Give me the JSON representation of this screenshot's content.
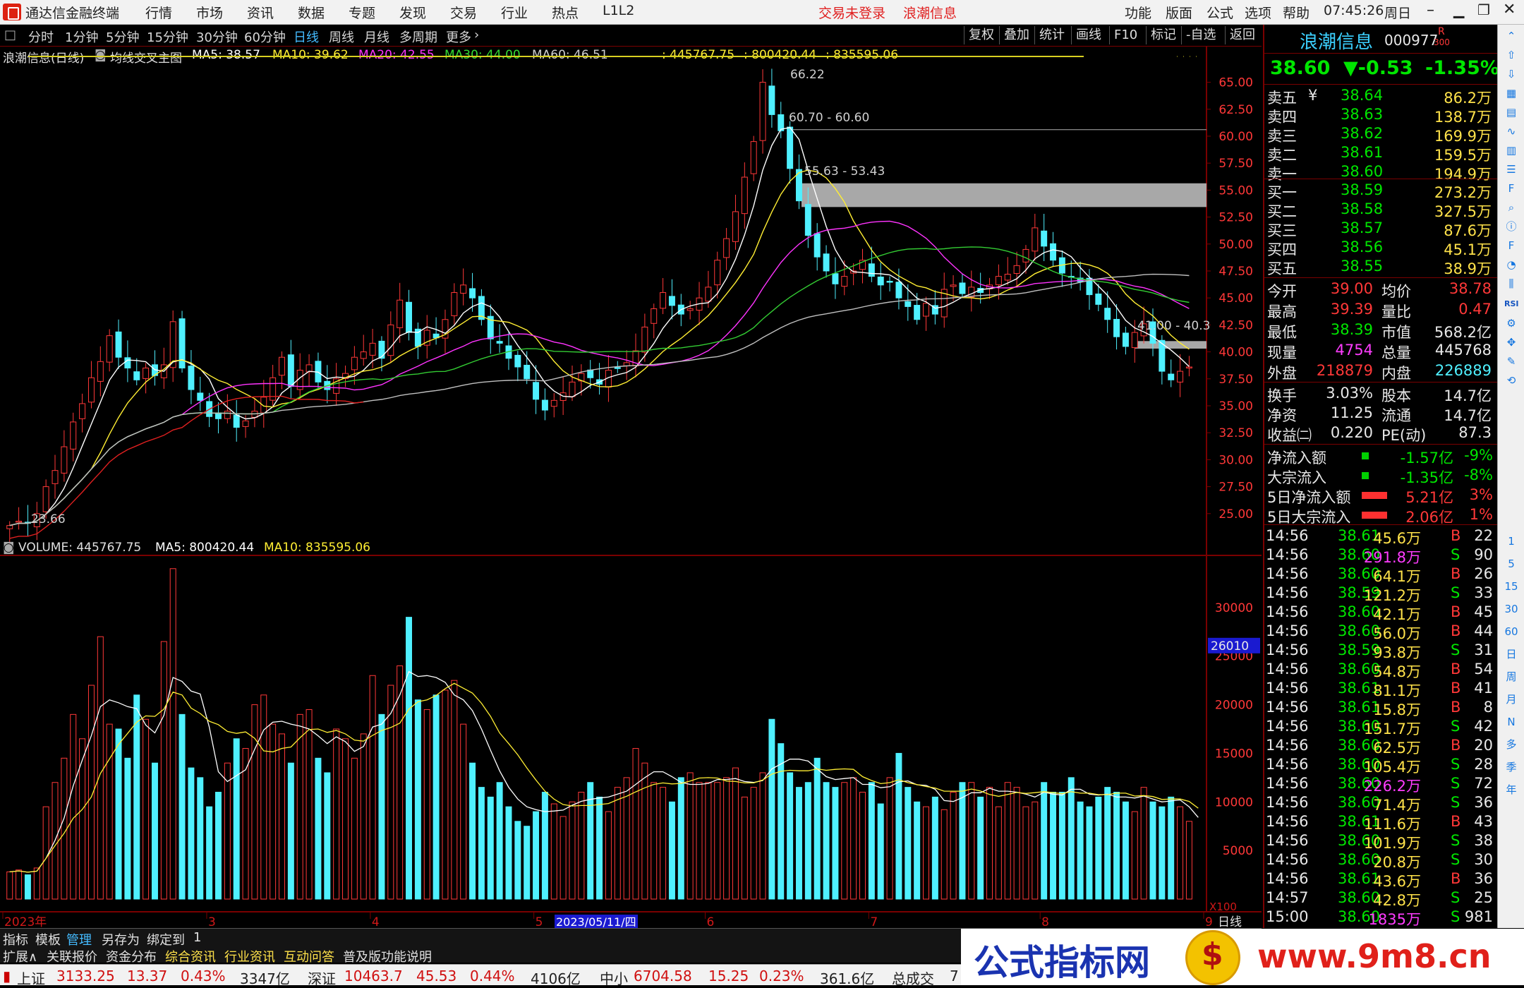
{
  "titlebar": {
    "app_title": "通达信金融终端",
    "menus": [
      "行情",
      "市场",
      "资讯",
      "数据",
      "专题",
      "发现",
      "交易",
      "行业",
      "热点",
      "L1L2"
    ],
    "trade_status": "交易未登录",
    "stock_name": "浪潮信息",
    "right_menus": [
      "功能",
      "版面",
      "公式",
      "选项",
      "帮助"
    ],
    "time": "07:45:26",
    "weekday": "周日"
  },
  "toolbar": {
    "periods": [
      "分时",
      "1分钟",
      "5分钟",
      "15分钟",
      "30分钟",
      "60分钟",
      "日线",
      "周线",
      "月线",
      "多周期",
      "更多"
    ],
    "selected": "日线",
    "right_buttons": [
      "复权",
      "叠加",
      "统计",
      "画线",
      "F10",
      "标记",
      "-自选",
      "返回"
    ]
  },
  "main_legend": {
    "title": "浪潮信息(日线)",
    "indicator": "均线交叉主图",
    "ma5": "MA5: 38.57",
    "ma10": "MA10: 39.62",
    "ma20": "MA20: 42.55",
    "ma30": "MA30: 44.00",
    "ma60": "MA60: 46.51",
    "v1": ": 445767.75",
    "v2": ": 800420.44",
    "v3": ": 835595.06"
  },
  "price_axis": [
    "65.00",
    "62.50",
    "60.00",
    "57.50",
    "55.00",
    "52.50",
    "50.00",
    "47.50",
    "45.00",
    "42.50",
    "40.00",
    "37.50",
    "35.00",
    "32.50",
    "30.00",
    "27.50",
    "25.00"
  ],
  "annotations": {
    "high": "66.22",
    "low": "23.66",
    "zone1": "60.70 - 60.60",
    "zone2": "55.63 - 53.43",
    "zone3": "41.00 - 40.3"
  },
  "volume_legend": {
    "title": "VOLUME: 445767.75",
    "ma5": "MA5: 800420.44",
    "ma10": "MA10: 835595.06"
  },
  "volume_axis": [
    "30000",
    "25000",
    "20000",
    "15000",
    "10000",
    "5000"
  ],
  "volume_marker": "26010",
  "volume_unit": "X100",
  "time_axis": {
    "labels": [
      "2023年",
      "3",
      "4",
      "5",
      "6",
      "7",
      "8",
      "9"
    ],
    "cursor_date": "2023/05/11/四",
    "period_label": "日线"
  },
  "quote": {
    "name": "浪潮信息",
    "code": "000977",
    "tag": "R",
    "tag2": "300",
    "price": "38.60",
    "change": "▼-0.53",
    "pct": "-1.35%",
    "asks": [
      {
        "label": "卖五",
        "price": "38.64",
        "vol": "86.2万"
      },
      {
        "label": "卖四",
        "price": "38.63",
        "vol": "138.7万"
      },
      {
        "label": "卖三",
        "price": "38.62",
        "vol": "169.9万"
      },
      {
        "label": "卖二",
        "price": "38.61",
        "vol": "159.5万"
      },
      {
        "label": "卖一",
        "price": "38.60",
        "vol": "194.9万"
      }
    ],
    "ask_mark": "¥",
    "bids": [
      {
        "label": "买一",
        "price": "38.59",
        "vol": "273.2万"
      },
      {
        "label": "买二",
        "price": "38.58",
        "vol": "327.5万"
      },
      {
        "label": "买三",
        "price": "38.57",
        "vol": "87.6万"
      },
      {
        "label": "买四",
        "price": "38.56",
        "vol": "45.1万"
      },
      {
        "label": "买五",
        "price": "38.55",
        "vol": "38.9万"
      }
    ],
    "stats": [
      {
        "l1": "今开",
        "v1": "39.00",
        "l2": "均价",
        "v2": "38.78"
      },
      {
        "l1": "最高",
        "v1": "39.39",
        "l2": "量比",
        "v2": "0.47"
      },
      {
        "l1": "最低",
        "v1": "38.39",
        "l2": "市值",
        "v2": "568.2亿"
      },
      {
        "l1": "现量",
        "v1": "4754",
        "l2": "总量",
        "v2": "445768"
      },
      {
        "l1": "外盘",
        "v1": "218879",
        "l2": "内盘",
        "v2": "226889"
      }
    ],
    "fund": [
      {
        "l1": "换手",
        "v1": "3.03%",
        "l2": "股本",
        "v2": "14.7亿"
      },
      {
        "l1": "净资",
        "v1": "11.25",
        "l2": "流通",
        "v2": "14.7亿"
      },
      {
        "l1": "收益㈡",
        "v1": "0.220",
        "l2": "PE(动)",
        "v2": "87.3"
      }
    ],
    "flows": [
      {
        "label": "净流入额",
        "value": "-1.57亿",
        "pct": "-9%"
      },
      {
        "label": "大宗流入",
        "value": "-1.35亿",
        "pct": "-8%"
      },
      {
        "label": "5日净流入额",
        "value": "5.21亿",
        "pct": "3%"
      },
      {
        "label": "5日大宗流入",
        "value": "2.06亿",
        "pct": "1%"
      }
    ],
    "ticks": [
      {
        "t": "14:56",
        "p": "38.61",
        "v": "45.6万",
        "bs": "B",
        "n": "22"
      },
      {
        "t": "14:56",
        "p": "38.60",
        "v": "291.8万",
        "bs": "S",
        "n": "90"
      },
      {
        "t": "14:56",
        "p": "38.60",
        "v": "64.1万",
        "bs": "B",
        "n": "26"
      },
      {
        "t": "14:56",
        "p": "38.59",
        "v": "121.2万",
        "bs": "S",
        "n": "33"
      },
      {
        "t": "14:56",
        "p": "38.60",
        "v": "42.1万",
        "bs": "B",
        "n": "45"
      },
      {
        "t": "14:56",
        "p": "38.60",
        "v": "56.0万",
        "bs": "B",
        "n": "44"
      },
      {
        "t": "14:56",
        "p": "38.59",
        "v": "93.8万",
        "bs": "S",
        "n": "31"
      },
      {
        "t": "14:56",
        "p": "38.60",
        "v": "54.8万",
        "bs": "B",
        "n": "54"
      },
      {
        "t": "14:56",
        "p": "38.61",
        "v": "81.1万",
        "bs": "B",
        "n": "41"
      },
      {
        "t": "14:56",
        "p": "38.61",
        "v": "15.8万",
        "bs": "B",
        "n": "8"
      },
      {
        "t": "14:56",
        "p": "38.60",
        "v": "151.7万",
        "bs": "S",
        "n": "42"
      },
      {
        "t": "14:56",
        "p": "38.60",
        "v": "62.5万",
        "bs": "B",
        "n": "20"
      },
      {
        "t": "14:56",
        "p": "38.60",
        "v": "105.4万",
        "bs": "S",
        "n": "28"
      },
      {
        "t": "14:56",
        "p": "38.60",
        "v": "226.2万",
        "bs": "S",
        "n": "72"
      },
      {
        "t": "14:56",
        "p": "38.60",
        "v": "71.4万",
        "bs": "S",
        "n": "36"
      },
      {
        "t": "14:56",
        "p": "38.61",
        "v": "111.6万",
        "bs": "B",
        "n": "43"
      },
      {
        "t": "14:56",
        "p": "38.60",
        "v": "101.9万",
        "bs": "S",
        "n": "38"
      },
      {
        "t": "14:56",
        "p": "38.60",
        "v": "20.8万",
        "bs": "S",
        "n": "30"
      },
      {
        "t": "14:56",
        "p": "38.61",
        "v": "43.6万",
        "bs": "B",
        "n": "36"
      },
      {
        "t": "14:57",
        "p": "38.60",
        "v": "42.8万",
        "bs": "S",
        "n": "25"
      },
      {
        "t": "15:00",
        "p": "38.60",
        "v": "1835万",
        "bs": "S",
        "n": "981"
      }
    ]
  },
  "side_icons": [
    "chevron-up-icon",
    "arrow-up-icon",
    "arrow-down-icon",
    "grid-icon",
    "table-icon",
    "line-chart-icon",
    "bar-chart-icon",
    "doc-icon",
    "f10-icon",
    "zoom-icon",
    "info-icon",
    "f2-icon",
    "pie-icon",
    "candle-icon",
    "rsi-icon",
    "settings-icon",
    "move-icon",
    "pen-icon",
    "refresh-icon"
  ],
  "side_labels": [
    "1",
    "5",
    "15",
    "30",
    "60",
    "日",
    "周",
    "月",
    "N",
    "多",
    "季",
    "年"
  ],
  "side_rsi": "RSI",
  "bottom_tabs1": [
    "指标",
    "模板",
    "管理",
    "另存为",
    "绑定到",
    "1"
  ],
  "bottom_tabs2": [
    "扩展∧",
    "关联报价",
    "资金分布",
    "综合资讯",
    "行业资讯",
    "互动问答",
    "普及版功能说明"
  ],
  "status": {
    "sh_label": "上证",
    "sh_val": "3133.25",
    "sh_chg": "13.37",
    "sh_pct": "0.43%",
    "sh_amt": "3347亿",
    "sz_label": "深证",
    "sz_val": "10463.7",
    "sz_chg": "45.53",
    "sz_pct": "0.44%",
    "sz_amt": "4106亿",
    "zx_label": "中小",
    "zx_val": "6704.58",
    "zx_chg": "15.25",
    "zx_pct": "0.23%",
    "zx_amt": "361.6亿",
    "total_label": "总成交",
    "total_val": "7"
  },
  "watermark": {
    "left": "公式指标网",
    "right": "www.9m8.cn"
  },
  "colors": {
    "up": "#ff3838",
    "down": "#4ff0ff",
    "ma5": "#ffffff",
    "ma10": "#ffee33",
    "ma20": "#ff33ff",
    "ma30": "#33cc33",
    "ma60": "#c0c0c0"
  },
  "chart_data": {
    "type": "candlestick",
    "title": "浪潮信息(日线)",
    "ylim": [
      22.5,
      67
    ],
    "high_point": 66.22,
    "low_point": 23.66,
    "x_months": [
      "2023年",
      "3",
      "4",
      "5",
      "6",
      "7",
      "8",
      "9"
    ],
    "close_approx": [
      23.9,
      24.3,
      24.1,
      25.0,
      27.5,
      29.0,
      31.2,
      33.5,
      35.2,
      37.6,
      39.1,
      41.5,
      39.5,
      38.5,
      37.4,
      38.5,
      37.8,
      38.8,
      42.8,
      38.5,
      36.5,
      35.5,
      34.0,
      33.8,
      34.5,
      33.0,
      33.6,
      34.5,
      35.8,
      37.6,
      39.5,
      36.8,
      38.3,
      38.8,
      37.2,
      36.5,
      37.5,
      38.0,
      39.5,
      40.0,
      40.8,
      39.4,
      42.5,
      44.8,
      41.8,
      40.5,
      42.0,
      41.3,
      43.0,
      45.5,
      46.2,
      45.0,
      43.0,
      41.2,
      40.8,
      39.4,
      38.6,
      37.5,
      35.6,
      34.6,
      35.5,
      36.2,
      37.2,
      38.0,
      37.6,
      37.0,
      38.3,
      38.5,
      39.0,
      40.1,
      42.3,
      44.0,
      45.5,
      44.3,
      43.5,
      44.0,
      45.0,
      46.0,
      48.5,
      50.5,
      53.0,
      56.2,
      59.5,
      65.0,
      62.0,
      60.5,
      57.0,
      54.0,
      50.8,
      48.8,
      47.5,
      46.3,
      47.0,
      47.5,
      48.5,
      47.0,
      46.2,
      46.5,
      45.0,
      44.2,
      43.0,
      44.5,
      43.5,
      45.8,
      46.2,
      45.4,
      46.0,
      45.5,
      46.2,
      47.0,
      47.2,
      48.0,
      49.5,
      51.5,
      49.8,
      48.5,
      47.3,
      47.0,
      46.5,
      45.3,
      44.4,
      43.0,
      41.4,
      40.5,
      41.8,
      42.6,
      40.8,
      38.2,
      37.4,
      38.2,
      38.6
    ],
    "volume_axis_max": 35000,
    "volume_approx": [
      2800,
      3000,
      2500,
      3200,
      9500,
      12000,
      14500,
      19000,
      16500,
      22000,
      27000,
      18000,
      17500,
      14500,
      21000,
      18500,
      14000,
      26500,
      34000,
      19000,
      13500,
      12500,
      9500,
      11000,
      14000,
      16500,
      15500,
      20000,
      21000,
      18000,
      17000,
      14000,
      19000,
      19500,
      14500,
      13000,
      17500,
      16500,
      14500,
      17000,
      23000,
      19000,
      22000,
      24000,
      29000,
      20500,
      19500,
      21000,
      21500,
      22500,
      18000,
      14000,
      11500,
      10500,
      12000,
      9500,
      8000,
      7500,
      9000,
      11000,
      9800,
      8500,
      10000,
      11000,
      12000,
      10500,
      9000,
      11500,
      12500,
      15500,
      14000,
      12000,
      11500,
      10000,
      12500,
      13000,
      12000,
      12000,
      12000,
      12500,
      13500,
      10500,
      11500,
      13000,
      18500,
      16000,
      13000,
      11500,
      12000,
      14500,
      12000,
      11500,
      12000,
      12500,
      11000,
      12000,
      9800,
      12500,
      15000,
      11500,
      10000,
      9500,
      10500,
      9200,
      11000,
      12000,
      12000,
      10500,
      11500,
      9500,
      12000,
      11500,
      9500,
      10000,
      12000,
      11000,
      11000,
      12500,
      10000,
      9500,
      10500,
      11500,
      11000,
      10000,
      9000,
      11500,
      10000,
      9500,
      10500,
      9500,
      8000,
      4500
    ]
  }
}
